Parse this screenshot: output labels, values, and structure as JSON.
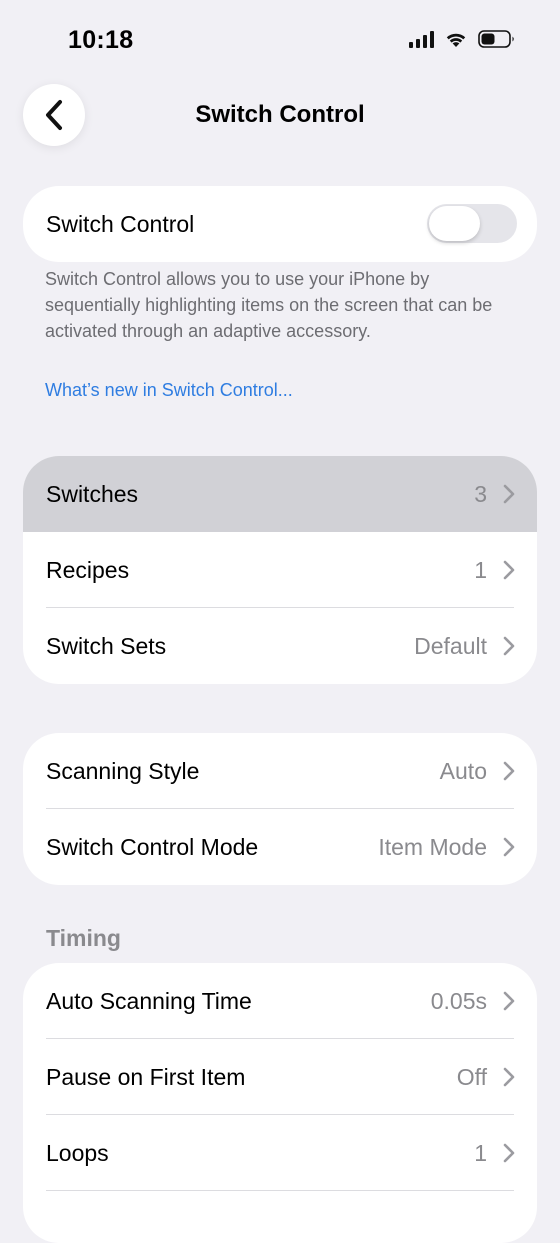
{
  "status_bar": {
    "time": "10:18",
    "icons": [
      "cellular-signal-icon",
      "wifi-icon",
      "battery-icon"
    ],
    "battery_level": 0.5
  },
  "nav": {
    "title": "Switch Control",
    "back_icon": "chevron-left-icon"
  },
  "main_toggle": {
    "label": "Switch Control",
    "on": false
  },
  "description": "Switch Control allows you to use your iPhone by sequentially highlighting items on the screen that can be activated through an adaptive accessory.",
  "link": "What’s new in Switch Control...",
  "group1": [
    {
      "label": "Switches",
      "value": "3",
      "highlighted": true
    },
    {
      "label": "Recipes",
      "value": "1"
    },
    {
      "label": "Switch Sets",
      "value": "Default"
    }
  ],
  "group2": [
    {
      "label": "Scanning Style",
      "value": "Auto"
    },
    {
      "label": "Switch Control Mode",
      "value": "Item Mode"
    }
  ],
  "timing": {
    "header": "Timing",
    "rows": [
      {
        "label": "Auto Scanning Time",
        "value": "0.05s"
      },
      {
        "label": "Pause on First Item",
        "value": "Off"
      },
      {
        "label": "Loops",
        "value": "1"
      }
    ]
  },
  "colors": {
    "background": "#f1f0f5",
    "accent_link": "#2f7de1",
    "secondary_text": "#8a8a8e",
    "highlight_row": "#d1d1d6"
  }
}
